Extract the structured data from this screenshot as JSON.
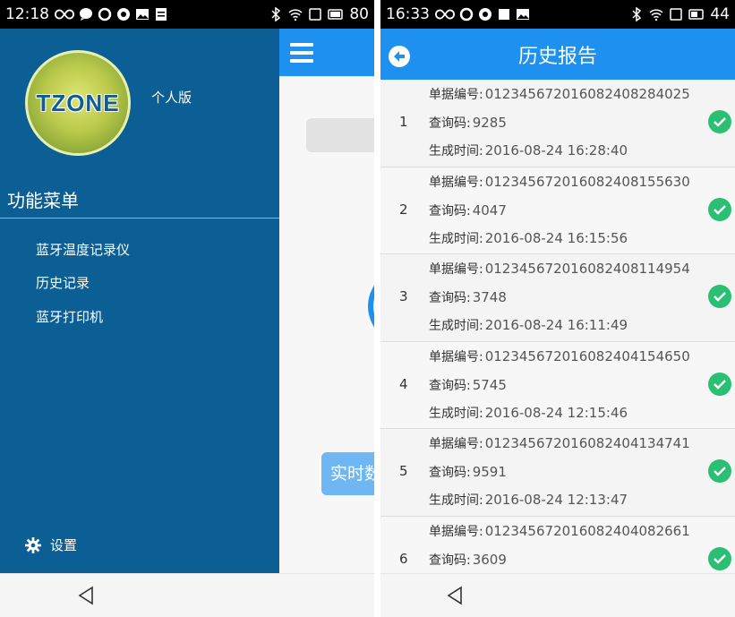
{
  "left_phone": {
    "status": {
      "time": "12:18",
      "battery": "80"
    },
    "drawer": {
      "logo_text": "TZONE",
      "edition": "个人版",
      "menu_title": "功能菜单",
      "items": [
        {
          "label": "蓝牙温度记录仪"
        },
        {
          "label": "历史记录"
        },
        {
          "label": "蓝牙打印机"
        }
      ],
      "settings_label": "设置"
    },
    "main": {
      "realtime_button": "实时数"
    }
  },
  "right_phone": {
    "status": {
      "time": "16:33",
      "battery": "44"
    },
    "title": "历史报告",
    "labels": {
      "number": "单据编号:",
      "query": "查询码:",
      "time": "生成时间:"
    },
    "reports": [
      {
        "index": "1",
        "number": "01234567201608240828402 5",
        "query": "9285",
        "time": "2016-08-24 16:28:40"
      },
      {
        "index": "2",
        "number": "012345672016082408155630",
        "query": "4047",
        "time": "2016-08-24 16:15:56"
      },
      {
        "index": "3",
        "number": "012345672016082408114954",
        "query": "3748",
        "time": "2016-08-24 16:11:49"
      },
      {
        "index": "4",
        "number": "012345672016082404154650",
        "query": "5745",
        "time": "2016-08-24 12:15:46"
      },
      {
        "index": "5",
        "number": "012345672016082404134741",
        "query": "9591",
        "time": "2016-08-24 12:13:47"
      },
      {
        "index": "6",
        "number": "012345672016082404082661",
        "query": "3609",
        "time": ""
      }
    ]
  },
  "colors": {
    "primary": "#1e90ef",
    "drawer": "#0b5f94",
    "check": "#2bbf73"
  }
}
